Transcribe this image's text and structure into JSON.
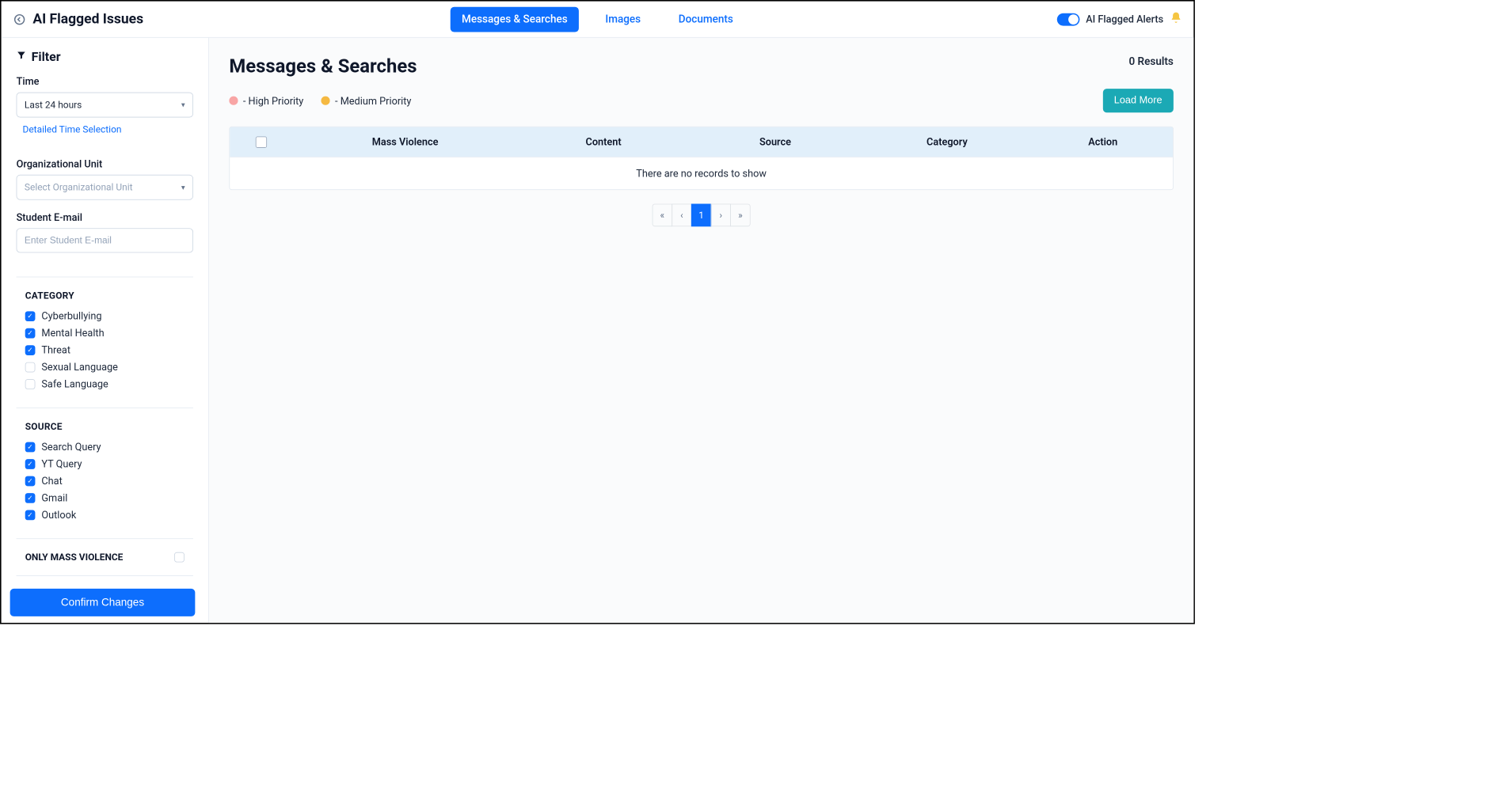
{
  "header": {
    "title": "AI Flagged Issues",
    "tabs": [
      {
        "label": "Messages & Searches",
        "active": true
      },
      {
        "label": "Images",
        "active": false
      },
      {
        "label": "Documents",
        "active": false
      }
    ],
    "alerts_label": "AI Flagged Alerts",
    "alerts_toggle_on": true
  },
  "sidebar": {
    "filter_title": "Filter",
    "time": {
      "label": "Time",
      "selected": "Last 24 hours",
      "detailed_link": "Detailed Time Selection"
    },
    "org_unit": {
      "label": "Organizational Unit",
      "placeholder": "Select Organizational Unit"
    },
    "student_email": {
      "label": "Student E-mail",
      "placeholder": "Enter Student E-mail"
    },
    "category": {
      "title": "CATEGORY",
      "items": [
        {
          "label": "Cyberbullying",
          "checked": true
        },
        {
          "label": "Mental Health",
          "checked": true
        },
        {
          "label": "Threat",
          "checked": true
        },
        {
          "label": "Sexual Language",
          "checked": false
        },
        {
          "label": "Safe Language",
          "checked": false
        }
      ]
    },
    "source": {
      "title": "SOURCE",
      "items": [
        {
          "label": "Search Query",
          "checked": true
        },
        {
          "label": "YT Query",
          "checked": true
        },
        {
          "label": "Chat",
          "checked": true
        },
        {
          "label": "Gmail",
          "checked": true
        },
        {
          "label": "Outlook",
          "checked": true
        }
      ]
    },
    "only_mass_violence": {
      "label": "ONLY MASS VIOLENCE",
      "checked": false
    },
    "confirm_button": "Confirm Changes"
  },
  "main": {
    "title": "Messages & Searches",
    "results_text": "0 Results",
    "priority_high": "- High Priority",
    "priority_medium": "- Medium Priority",
    "load_more": "Load More",
    "columns": [
      "Mass Violence",
      "Content",
      "Source",
      "Category",
      "Action"
    ],
    "empty_message": "There are no records to show",
    "pagination": {
      "first": "«",
      "prev": "‹",
      "current": "1",
      "next": "›",
      "last": "»"
    }
  }
}
